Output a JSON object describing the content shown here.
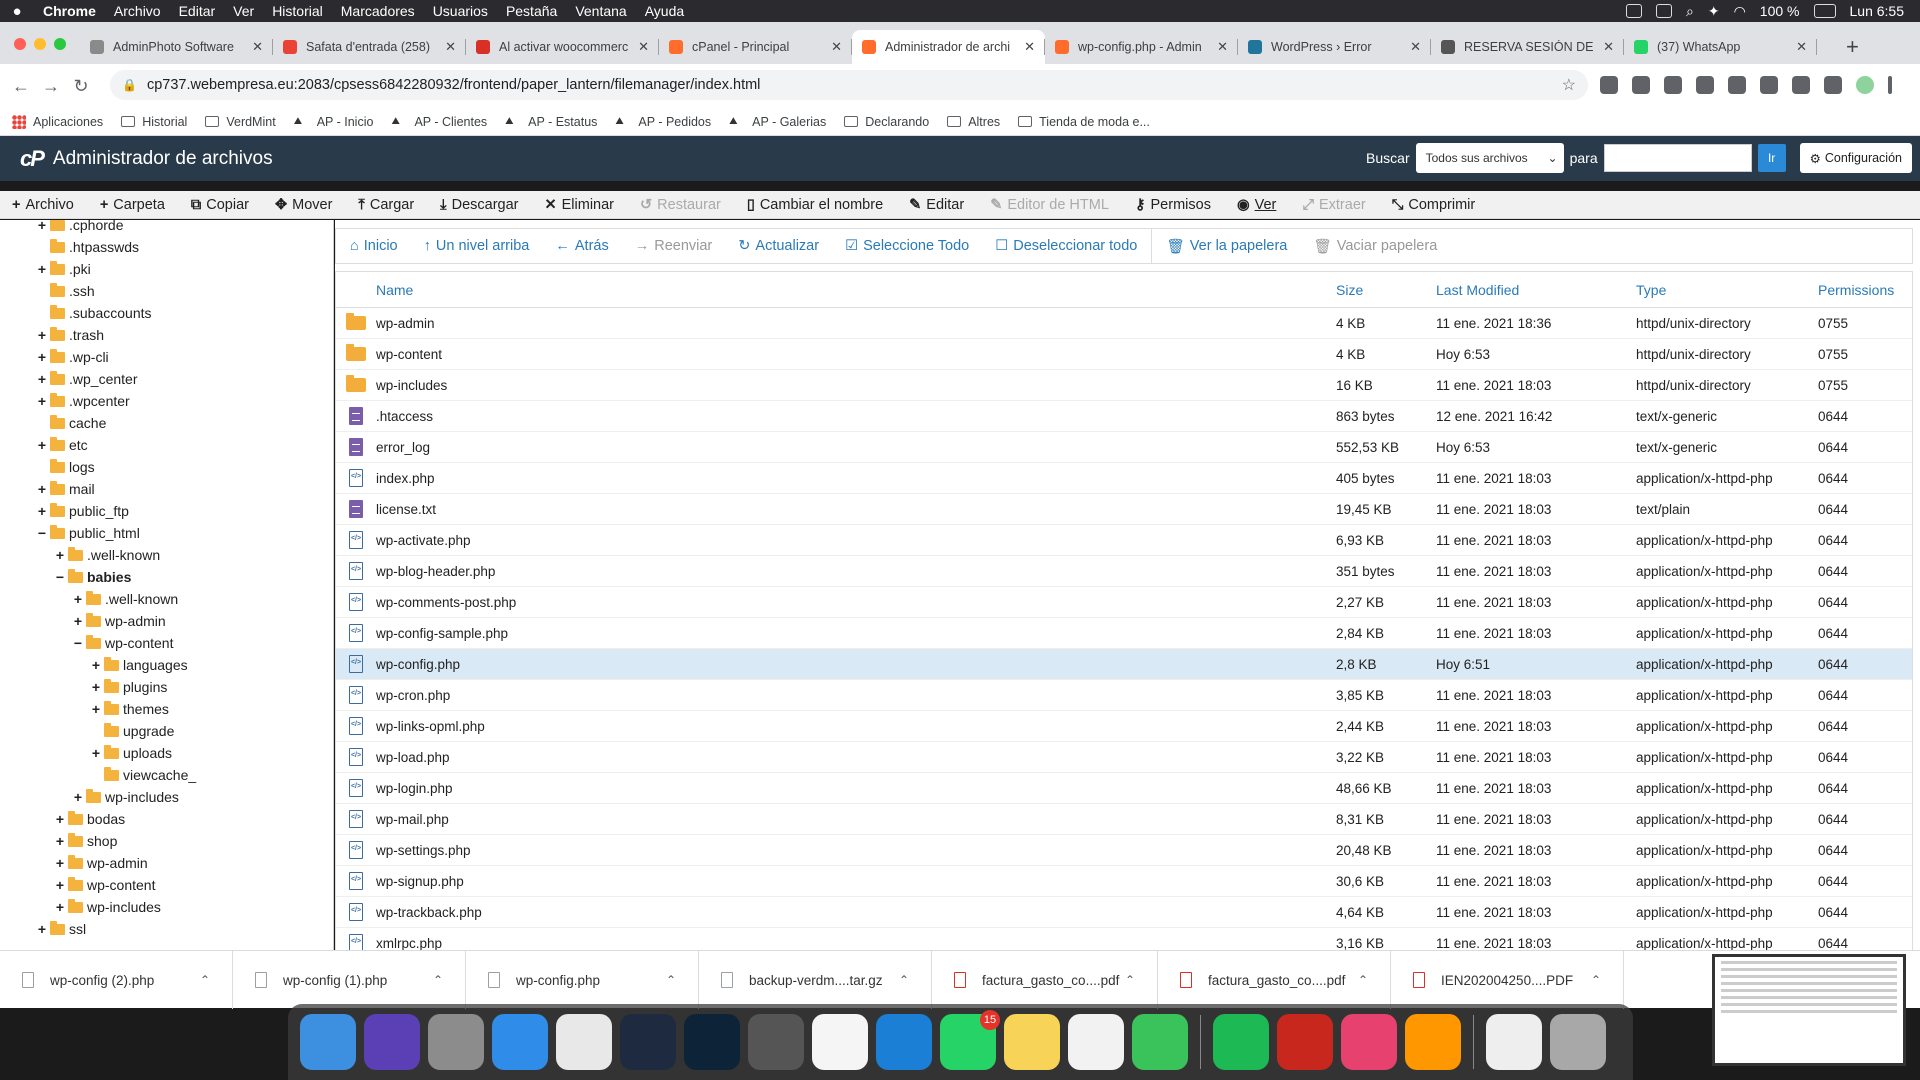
{
  "menubar": {
    "items": [
      "Chrome",
      "Archivo",
      "Editar",
      "Ver",
      "Historial",
      "Marcadores",
      "Usuarios",
      "Pestaña",
      "Ventana",
      "Ayuda"
    ],
    "battery": "100 %",
    "clock": "Lun 6:55"
  },
  "tabs": [
    {
      "title": "AdminPhoto Software",
      "color": "#8a8a8a"
    },
    {
      "title": "Safata d'entrada (258)",
      "color": "#ea4335"
    },
    {
      "title": "Al activar woocommerc",
      "color": "#d93025"
    },
    {
      "title": "cPanel - Principal",
      "color": "#ff6c2c"
    },
    {
      "title": "Administrador de archi",
      "color": "#ff6c2c"
    },
    {
      "title": "wp-config.php - Admin",
      "color": "#ff6c2c"
    },
    {
      "title": "WordPress › Error",
      "color": "#21759b"
    },
    {
      "title": "RESERVA SESIÓN DE E",
      "color": "#555555"
    },
    {
      "title": "(37) WhatsApp",
      "color": "#25d366"
    }
  ],
  "address": {
    "url": "cp737.webempresa.eu:2083/cpsess6842280932/frontend/paper_lantern/filemanager/index.html"
  },
  "bookmarks": [
    "Aplicaciones",
    "Historial",
    "VerdMint",
    "AP - Inicio",
    "AP - Clientes",
    "AP - Estatus",
    "AP - Pedidos",
    "AP - Galerias",
    "Declarando",
    "Altres",
    "Tienda de moda e..."
  ],
  "cpanel": {
    "logo": "cP",
    "title": "Administrador de archivos",
    "search_label": "Buscar",
    "search_scope": "Todos sus archivos",
    "for_label": "para",
    "go": "Ir",
    "config": "Configuración"
  },
  "actions": [
    {
      "label": "Archivo",
      "icon": "+",
      "disabled": false
    },
    {
      "label": "Carpeta",
      "icon": "+",
      "disabled": false
    },
    {
      "label": "Copiar",
      "icon": "⧉",
      "disabled": false
    },
    {
      "label": "Mover",
      "icon": "✥",
      "disabled": false
    },
    {
      "label": "Cargar",
      "icon": "⤒",
      "disabled": false
    },
    {
      "label": "Descargar",
      "icon": "⤓",
      "disabled": false
    },
    {
      "label": "Eliminar",
      "icon": "✕",
      "disabled": false
    },
    {
      "label": "Restaurar",
      "icon": "↺",
      "disabled": true
    },
    {
      "label": "Cambiar el nombre",
      "icon": "▯",
      "disabled": false
    },
    {
      "label": "Editar",
      "icon": "✎",
      "disabled": false
    },
    {
      "label": "Editor de HTML",
      "icon": "✎",
      "disabled": true
    },
    {
      "label": "Permisos",
      "icon": "⚷",
      "disabled": false
    },
    {
      "label": "Ver",
      "icon": "◉",
      "disabled": false
    },
    {
      "label": "Extraer",
      "icon": "⤢",
      "disabled": true
    },
    {
      "label": "Comprimir",
      "icon": "⤡",
      "disabled": false
    }
  ],
  "tree": [
    {
      "label": ".cphorde",
      "depth": 0,
      "toggle": "+"
    },
    {
      "label": ".htpasswds",
      "depth": 0,
      "toggle": ""
    },
    {
      "label": ".pki",
      "depth": 0,
      "toggle": "+"
    },
    {
      "label": ".ssh",
      "depth": 0,
      "toggle": ""
    },
    {
      "label": ".subaccounts",
      "depth": 0,
      "toggle": ""
    },
    {
      "label": ".trash",
      "depth": 0,
      "toggle": "+"
    },
    {
      "label": ".wp-cli",
      "depth": 0,
      "toggle": "+"
    },
    {
      "label": ".wp_center",
      "depth": 0,
      "toggle": "+"
    },
    {
      "label": ".wpcenter",
      "depth": 0,
      "toggle": "+"
    },
    {
      "label": "cache",
      "depth": 0,
      "toggle": ""
    },
    {
      "label": "etc",
      "depth": 0,
      "toggle": "+"
    },
    {
      "label": "logs",
      "depth": 0,
      "toggle": ""
    },
    {
      "label": "mail",
      "depth": 0,
      "toggle": "+"
    },
    {
      "label": "public_ftp",
      "depth": 0,
      "toggle": "+"
    },
    {
      "label": "public_html",
      "depth": 0,
      "toggle": "−"
    },
    {
      "label": ".well-known",
      "depth": 1,
      "toggle": "+"
    },
    {
      "label": "babies",
      "depth": 1,
      "toggle": "−",
      "bold": true
    },
    {
      "label": ".well-known",
      "depth": 2,
      "toggle": "+"
    },
    {
      "label": "wp-admin",
      "depth": 2,
      "toggle": "+"
    },
    {
      "label": "wp-content",
      "depth": 2,
      "toggle": "−"
    },
    {
      "label": "languages",
      "depth": 3,
      "toggle": "+"
    },
    {
      "label": "plugins",
      "depth": 3,
      "toggle": "+"
    },
    {
      "label": "themes",
      "depth": 3,
      "toggle": "+"
    },
    {
      "label": "upgrade",
      "depth": 3,
      "toggle": ""
    },
    {
      "label": "uploads",
      "depth": 3,
      "toggle": "+"
    },
    {
      "label": "viewcache_",
      "depth": 3,
      "toggle": ""
    },
    {
      "label": "wp-includes",
      "depth": 2,
      "toggle": "+"
    },
    {
      "label": "bodas",
      "depth": 1,
      "toggle": "+"
    },
    {
      "label": "shop",
      "depth": 1,
      "toggle": "+"
    },
    {
      "label": "wp-admin",
      "depth": 1,
      "toggle": "+"
    },
    {
      "label": "wp-content",
      "depth": 1,
      "toggle": "+"
    },
    {
      "label": "wp-includes",
      "depth": 1,
      "toggle": "+"
    },
    {
      "label": "ssl",
      "depth": 0,
      "toggle": "+"
    }
  ],
  "subbar": [
    {
      "label": "Inicio",
      "icon": "⌂",
      "disabled": false
    },
    {
      "label": "Un nivel arriba",
      "icon": "↑",
      "disabled": false
    },
    {
      "label": "Atrás",
      "icon": "←",
      "disabled": false
    },
    {
      "label": "Reenviar",
      "icon": "→",
      "disabled": true
    },
    {
      "label": "Actualizar",
      "icon": "↻",
      "disabled": false
    },
    {
      "label": "Seleccione Todo",
      "icon": "☑",
      "disabled": false
    },
    {
      "label": "Deseleccionar todo",
      "icon": "☐",
      "disabled": false,
      "sep_after": true
    },
    {
      "label": "Ver la papelera",
      "icon": "🗑",
      "disabled": false
    },
    {
      "label": "Vaciar papelera",
      "icon": "🗑",
      "disabled": true
    }
  ],
  "columns": {
    "name": "Name",
    "size": "Size",
    "modified": "Last Modified",
    "type": "Type",
    "perms": "Permissions"
  },
  "files": [
    {
      "icon": "folder",
      "name": "wp-admin",
      "size": "4 KB",
      "modified": "11 ene. 2021 18:36",
      "type": "httpd/unix-directory",
      "perms": "0755"
    },
    {
      "icon": "folder",
      "name": "wp-content",
      "size": "4 KB",
      "modified": "Hoy 6:53",
      "type": "httpd/unix-directory",
      "perms": "0755"
    },
    {
      "icon": "folder",
      "name": "wp-includes",
      "size": "16 KB",
      "modified": "11 ene. 2021 18:03",
      "type": "httpd/unix-directory",
      "perms": "0755"
    },
    {
      "icon": "text",
      "name": ".htaccess",
      "size": "863 bytes",
      "modified": "12 ene. 2021 16:42",
      "type": "text/x-generic",
      "perms": "0644"
    },
    {
      "icon": "text",
      "name": "error_log",
      "size": "552,53 KB",
      "modified": "Hoy 6:53",
      "type": "text/x-generic",
      "perms": "0644"
    },
    {
      "icon": "php",
      "name": "index.php",
      "size": "405 bytes",
      "modified": "11 ene. 2021 18:03",
      "type": "application/x-httpd-php",
      "perms": "0644"
    },
    {
      "icon": "text",
      "name": "license.txt",
      "size": "19,45 KB",
      "modified": "11 ene. 2021 18:03",
      "type": "text/plain",
      "perms": "0644"
    },
    {
      "icon": "php",
      "name": "wp-activate.php",
      "size": "6,93 KB",
      "modified": "11 ene. 2021 18:03",
      "type": "application/x-httpd-php",
      "perms": "0644"
    },
    {
      "icon": "php",
      "name": "wp-blog-header.php",
      "size": "351 bytes",
      "modified": "11 ene. 2021 18:03",
      "type": "application/x-httpd-php",
      "perms": "0644"
    },
    {
      "icon": "php",
      "name": "wp-comments-post.php",
      "size": "2,27 KB",
      "modified": "11 ene. 2021 18:03",
      "type": "application/x-httpd-php",
      "perms": "0644"
    },
    {
      "icon": "php",
      "name": "wp-config-sample.php",
      "size": "2,84 KB",
      "modified": "11 ene. 2021 18:03",
      "type": "application/x-httpd-php",
      "perms": "0644"
    },
    {
      "icon": "php",
      "name": "wp-config.php",
      "size": "2,8 KB",
      "modified": "Hoy 6:51",
      "type": "application/x-httpd-php",
      "perms": "0644",
      "selected": true
    },
    {
      "icon": "php",
      "name": "wp-cron.php",
      "size": "3,85 KB",
      "modified": "11 ene. 2021 18:03",
      "type": "application/x-httpd-php",
      "perms": "0644"
    },
    {
      "icon": "php",
      "name": "wp-links-opml.php",
      "size": "2,44 KB",
      "modified": "11 ene. 2021 18:03",
      "type": "application/x-httpd-php",
      "perms": "0644"
    },
    {
      "icon": "php",
      "name": "wp-load.php",
      "size": "3,22 KB",
      "modified": "11 ene. 2021 18:03",
      "type": "application/x-httpd-php",
      "perms": "0644"
    },
    {
      "icon": "php",
      "name": "wp-login.php",
      "size": "48,66 KB",
      "modified": "11 ene. 2021 18:03",
      "type": "application/x-httpd-php",
      "perms": "0644"
    },
    {
      "icon": "php",
      "name": "wp-mail.php",
      "size": "8,31 KB",
      "modified": "11 ene. 2021 18:03",
      "type": "application/x-httpd-php",
      "perms": "0644"
    },
    {
      "icon": "php",
      "name": "wp-settings.php",
      "size": "20,48 KB",
      "modified": "11 ene. 2021 18:03",
      "type": "application/x-httpd-php",
      "perms": "0644"
    },
    {
      "icon": "php",
      "name": "wp-signup.php",
      "size": "30,6 KB",
      "modified": "11 ene. 2021 18:03",
      "type": "application/x-httpd-php",
      "perms": "0644"
    },
    {
      "icon": "php",
      "name": "wp-trackback.php",
      "size": "4,64 KB",
      "modified": "11 ene. 2021 18:03",
      "type": "application/x-httpd-php",
      "perms": "0644"
    },
    {
      "icon": "php",
      "name": "xmlrpc.php",
      "size": "3,16 KB",
      "modified": "11 ene. 2021 18:03",
      "type": "application/x-httpd-php",
      "perms": "0644"
    }
  ],
  "downloads": [
    {
      "name": "wp-config (2).php",
      "pdf": false
    },
    {
      "name": "wp-config (1).php",
      "pdf": false
    },
    {
      "name": "wp-config.php",
      "pdf": false
    },
    {
      "name": "backup-verdm....tar.gz",
      "pdf": false
    },
    {
      "name": "factura_gasto_co....pdf",
      "pdf": true
    },
    {
      "name": "factura_gasto_co....pdf",
      "pdf": true
    },
    {
      "name": "IEN202004250....PDF",
      "pdf": true
    }
  ],
  "dock": [
    {
      "name": "finder-icon",
      "color": "#3d8fe0"
    },
    {
      "name": "siri-icon",
      "color": "#5b3fb5"
    },
    {
      "name": "launchpad-icon",
      "color": "#8c8c8c"
    },
    {
      "name": "safari-icon",
      "color": "#2f8ce8"
    },
    {
      "name": "chrome-icon",
      "color": "#e8e8e8"
    },
    {
      "name": "lightroom-icon",
      "color": "#1d2a3f"
    },
    {
      "name": "photoshop-icon",
      "color": "#0d2438"
    },
    {
      "name": "aperture-icon",
      "color": "#555555"
    },
    {
      "name": "calendar-icon",
      "color": "#f5f5f5"
    },
    {
      "name": "trello-icon",
      "color": "#1b7fd6"
    },
    {
      "name": "whatsapp-icon",
      "color": "#25d366",
      "badge": "15"
    },
    {
      "name": "notes-icon",
      "color": "#f7d358"
    },
    {
      "name": "reminders-icon",
      "color": "#f2f2f2"
    },
    {
      "name": "facetime-icon",
      "color": "#3ac35a"
    },
    {
      "name": "spotify-icon",
      "color": "#1db954"
    },
    {
      "name": "acrobat-icon",
      "color": "#c7271d"
    },
    {
      "name": "creative-cloud-icon",
      "color": "#e6416f"
    },
    {
      "name": "sublime-icon",
      "color": "#ff9800"
    },
    {
      "name": "document-icon",
      "color": "#eeeeee"
    },
    {
      "name": "trash-icon",
      "color": "#a8a8a8"
    }
  ]
}
